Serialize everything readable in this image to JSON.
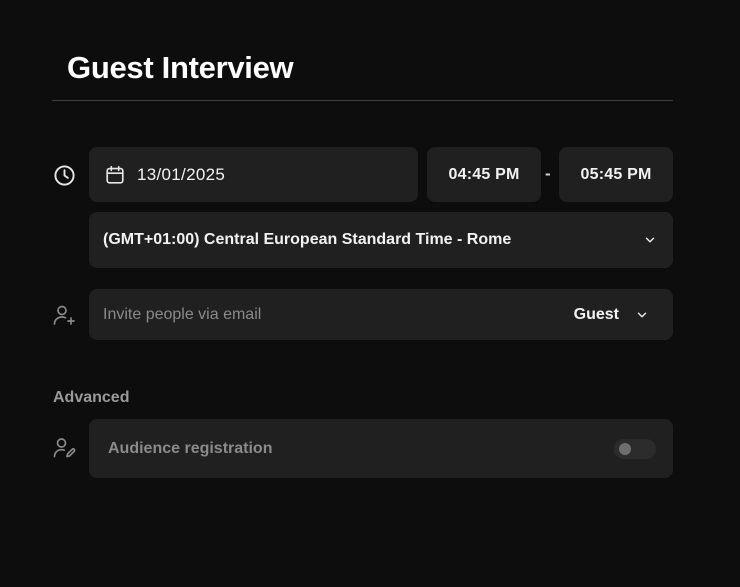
{
  "page": {
    "title": "Guest Interview"
  },
  "schedule": {
    "date": "13/01/2025",
    "start_time": "04:45 PM",
    "separator": "-",
    "end_time": "05:45 PM",
    "timezone": "(GMT+01:00) Central European Standard Time - Rome"
  },
  "invite": {
    "placeholder": "Invite people via email",
    "value": "",
    "role": "Guest"
  },
  "advanced": {
    "label": "Advanced",
    "audience_registration_label": "Audience registration",
    "audience_registration_enabled": false
  },
  "icons": {
    "schedule": "clock-icon",
    "date": "calendar-icon",
    "invite": "user-plus-icon",
    "audience": "user-edit-icon",
    "dropdown": "chevron-down-icon"
  },
  "colors": {
    "background": "#0d0d0d",
    "field": "#202020",
    "text": "#f2f2f2",
    "muted": "#8a8a8a"
  }
}
